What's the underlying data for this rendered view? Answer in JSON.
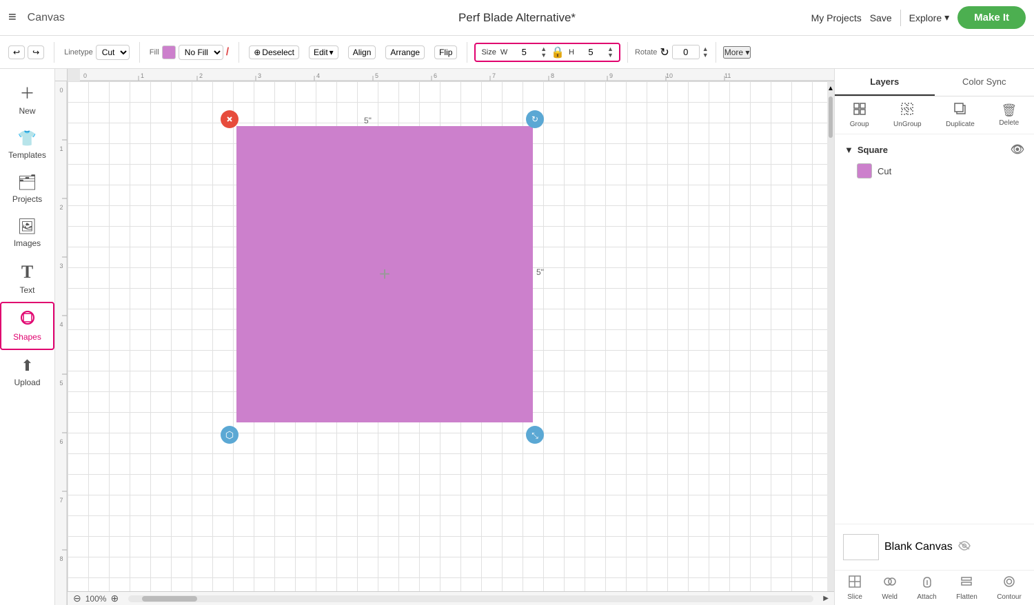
{
  "header": {
    "menu_label": "≡",
    "app_title": "Canvas",
    "project_name": "Perf Blade Alternative*",
    "my_projects_label": "My Projects",
    "save_label": "Save",
    "divider": "|",
    "explore_label": "Explore",
    "explore_chevron": "▾",
    "make_it_label": "Make It"
  },
  "toolbar": {
    "undo_icon": "↩",
    "redo_icon": "↪",
    "linetype_label": "Linetype",
    "linetype_value": "Cut",
    "fill_label": "Fill",
    "fill_value": "No Fill",
    "fill_color": "#cc80cc",
    "pencil_symbol": "/",
    "deselect_label": "Deselect",
    "edit_label": "Edit",
    "align_label": "Align",
    "arrange_label": "Arrange",
    "flip_label": "Flip",
    "size_label": "Size",
    "width_label": "W",
    "width_value": "5",
    "height_label": "H",
    "height_value": "5",
    "lock_symbol": "🔒",
    "rotate_label": "Rotate",
    "rotate_icon": "↻",
    "rotate_value": "0",
    "more_label": "More ▾"
  },
  "sidebar": {
    "items": [
      {
        "id": "new",
        "icon": "＋",
        "label": "New"
      },
      {
        "id": "templates",
        "icon": "👕",
        "label": "Templates"
      },
      {
        "id": "projects",
        "icon": "🗂",
        "label": "Projects"
      },
      {
        "id": "images",
        "icon": "🖼",
        "label": "Images"
      },
      {
        "id": "text",
        "icon": "T",
        "label": "Text"
      },
      {
        "id": "shapes",
        "icon": "◉",
        "label": "Shapes"
      },
      {
        "id": "upload",
        "icon": "⬆",
        "label": "Upload"
      }
    ]
  },
  "canvas": {
    "ruler_marks": [
      "0",
      "1",
      "2",
      "3",
      "4",
      "5",
      "6",
      "7",
      "8",
      "9",
      "10",
      "11"
    ],
    "ruler_v_marks": [
      "0",
      "1",
      "2",
      "3",
      "4",
      "5",
      "6",
      "7",
      "8"
    ],
    "zoom_label": "100%",
    "zoom_minus": "⊖",
    "zoom_plus": "⊕",
    "label_5h": "5\"",
    "label_5v": "5\""
  },
  "shape": {
    "color": "#cc80cc",
    "handle_delete": "✕",
    "handle_rotate": "↻",
    "handle_scale_bl": "⬡",
    "handle_scale_br": "⤡",
    "cross": "+"
  },
  "right_panel": {
    "tab_layers": "Layers",
    "tab_color_sync": "Color Sync",
    "action_group": {
      "label": "Group",
      "icon": "⊞"
    },
    "action_ungroup": {
      "label": "UnGroup",
      "icon": "⊟"
    },
    "action_duplicate": {
      "label": "Duplicate",
      "icon": "⧉"
    },
    "action_delete": {
      "label": "Delete",
      "icon": "🗑"
    },
    "layer_name": "Square",
    "layer_expand": "▼",
    "layer_item_label": "Cut",
    "layer_eye": "👁",
    "blank_canvas_label": "Blank Canvas",
    "blank_canvas_hide": "👁",
    "bottom_tools": [
      {
        "id": "slice",
        "icon": "✂",
        "label": "Slice"
      },
      {
        "id": "weld",
        "icon": "⬡",
        "label": "Weld"
      },
      {
        "id": "attach",
        "icon": "📎",
        "label": "Attach"
      },
      {
        "id": "flatten",
        "icon": "⬣",
        "label": "Flatten"
      },
      {
        "id": "contour",
        "icon": "◎",
        "label": "Contour"
      }
    ]
  }
}
